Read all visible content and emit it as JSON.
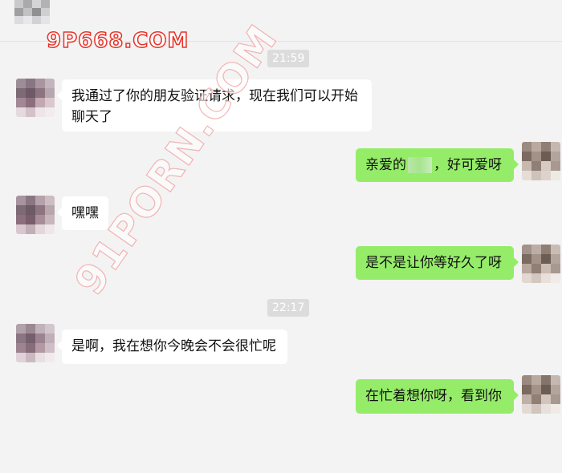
{
  "chat": {
    "timestamps": [
      "21:59",
      "22:17"
    ],
    "messages": [
      {
        "side": "left",
        "text": "我通过了你的朋友验证请求，现在我们可以开始聊天了"
      },
      {
        "side": "right",
        "text_before": "亲爱的",
        "text_after": "，好可爱呀"
      },
      {
        "side": "left",
        "text": "嘿嘿"
      },
      {
        "side": "right",
        "text": "是不是让你等好久了呀"
      },
      {
        "side": "left",
        "text": "是啊，我在想你今晚会不会很忙呢"
      },
      {
        "side": "right",
        "text": "在忙着想你呀，看到你"
      }
    ]
  },
  "watermarks": {
    "top": "9P668.COM",
    "diagonal": "91PORN.COM"
  },
  "colors": {
    "background": "#f3f3f3",
    "self_bubble": "#95ec69",
    "other_bubble": "#ffffff",
    "time_pill": "#dcdcdc",
    "watermark_stroke": "#e6342a"
  }
}
